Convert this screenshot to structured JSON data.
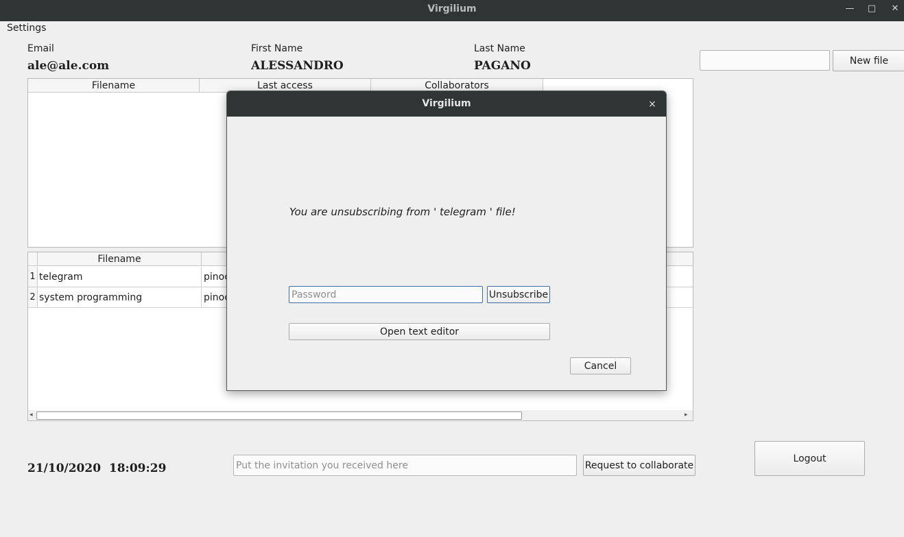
{
  "window": {
    "title": "Virgilium",
    "controls": [
      "—",
      "□",
      "✕"
    ]
  },
  "menu": {
    "settings": "Settings"
  },
  "user": {
    "email_label": "Email",
    "email": "ale@ale.com",
    "first_name_label": "First Name",
    "first_name": "ALESSANDRO",
    "last_name_label": "Last Name",
    "last_name": "PAGANO"
  },
  "new_file": {
    "input_value": "",
    "button": "New file"
  },
  "files_table": {
    "headers": [
      "Filename",
      "Last access",
      "Collaborators"
    ]
  },
  "shared_table": {
    "headers": [
      "Filename"
    ],
    "rows": [
      {
        "num": "1",
        "filename": "telegram",
        "owner": "pinoc"
      },
      {
        "num": "2",
        "filename": "system programming",
        "owner": "pinoc"
      }
    ]
  },
  "datetime": "21/10/2020  18:09:29",
  "invitation": {
    "placeholder": "Put the invitation you received here",
    "button": "Request to collaborate"
  },
  "logout": "Logout",
  "dialog": {
    "title": "Virgilium",
    "close": "×",
    "message": "You are unsubscribing from ' telegram ' file!",
    "password_placeholder": "Password",
    "unsubscribe": "Unsubscribe",
    "open_editor": "Open text editor",
    "cancel": "Cancel"
  }
}
